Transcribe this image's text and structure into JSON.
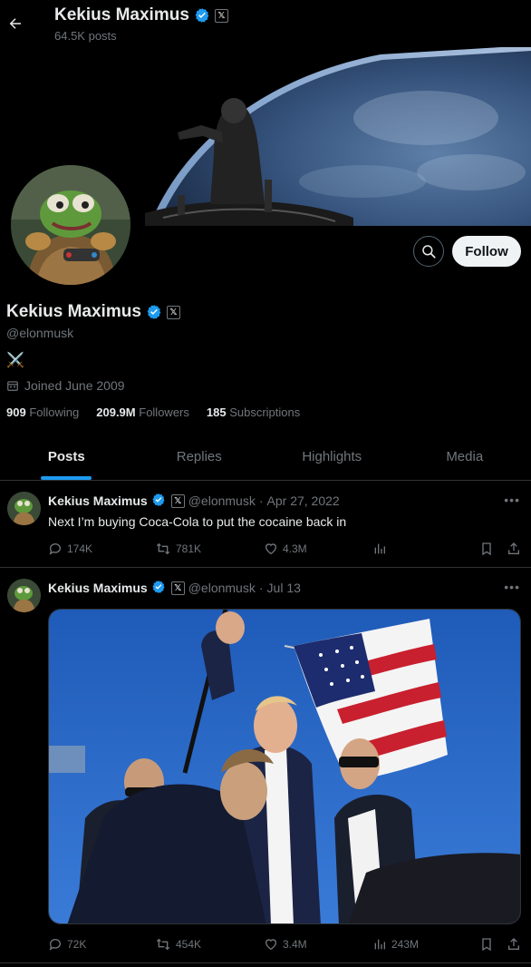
{
  "header": {
    "name": "Kekius Maximus",
    "posts_count": "64.5K posts"
  },
  "profile": {
    "name": "Kekius Maximus",
    "handle": "@elonmusk",
    "bio": "⚔️",
    "joined": "Joined June 2009",
    "follow_label": "Follow",
    "stats": {
      "following_num": "909",
      "following_label": "Following",
      "followers_num": "209.9M",
      "followers_label": "Followers",
      "subs_num": "185",
      "subs_label": "Subscriptions"
    }
  },
  "tabs": [
    {
      "label": "Posts",
      "active": true
    },
    {
      "label": "Replies",
      "active": false
    },
    {
      "label": "Highlights",
      "active": false
    },
    {
      "label": "Media",
      "active": false
    }
  ],
  "posts": [
    {
      "author": "Kekius Maximus",
      "handle": "@elonmusk",
      "sep": "·",
      "date": "Apr 27, 2022",
      "text": "Next I’m buying Coca-Cola to put the cocaine back in",
      "replies": "174K",
      "reposts": "781K",
      "likes": "4.3M",
      "views": ""
    },
    {
      "author": "Kekius Maximus",
      "handle": "@elonmusk",
      "sep": "·",
      "date": "Jul 13",
      "text": "",
      "replies": "72K",
      "reposts": "454K",
      "likes": "3.4M",
      "views": "243M"
    }
  ],
  "colors": {
    "accent": "#1d9bf0",
    "background": "#000000",
    "text": "#e7e9ea",
    "muted": "#71767b",
    "border": "#2f3336"
  },
  "icons": {
    "back": "arrow-left-icon",
    "verified": "verified-badge-icon",
    "affiliate": "x-logo-icon",
    "search": "search-icon",
    "calendar": "calendar-icon",
    "reply": "reply-icon",
    "repost": "repost-icon",
    "like": "heart-icon",
    "views": "views-icon",
    "bookmark": "bookmark-icon",
    "share": "share-icon",
    "more": "more-icon"
  }
}
